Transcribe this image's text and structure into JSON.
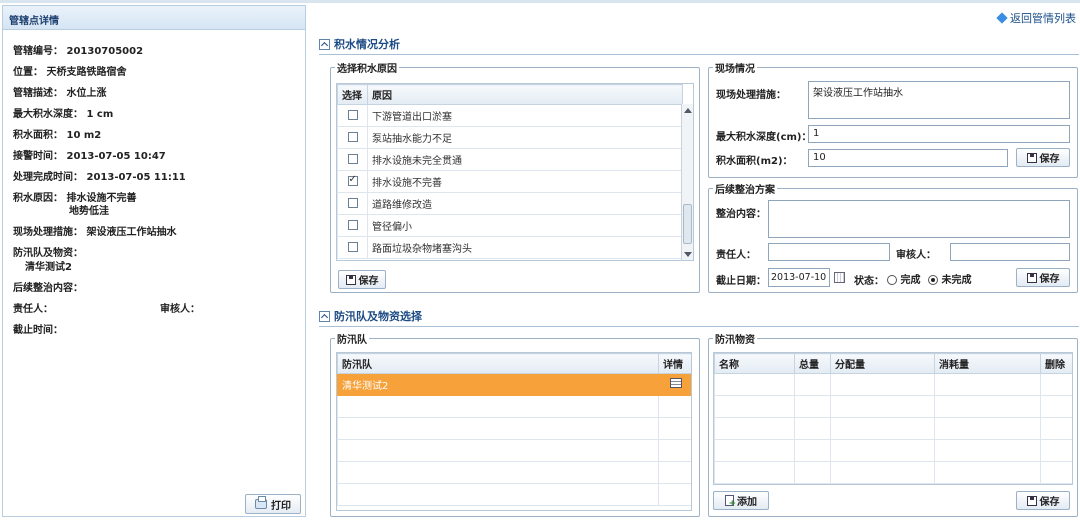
{
  "left": {
    "header": "管辖点详情",
    "fields": [
      {
        "label": "管辖编号：",
        "value": "20130705002"
      },
      {
        "label": "位置：",
        "value": "天桥支路铁路宿舍"
      },
      {
        "label": "管辖描述：",
        "value": "水位上涨"
      },
      {
        "label": "最大积水深度：",
        "value": "1 cm"
      },
      {
        "label": "积水面积：",
        "value": "10 m2"
      },
      {
        "label": "接警时间：",
        "value": "2013-07-05 10:47"
      },
      {
        "label": "处理完成时间：",
        "value": "2013-07-05 11:11"
      },
      {
        "label": "积水原因：",
        "value": "排水设施不完善"
      }
    ],
    "cause_second": "地势低洼",
    "onsite_label": "现场处理措施：",
    "onsite_value": "架设液压工作站抽水",
    "team_label": "防汛队及物资：",
    "team_value": "清华测试2",
    "plan_label": "后续整治内容：",
    "responsible_label": "责任人：",
    "reviewer_label": "审核人：",
    "deadline_label": "截止时间：",
    "print_label": "打印"
  },
  "return_link": "返回管情列表",
  "section1": {
    "title": "积水情况分析"
  },
  "cause_box": {
    "legend": "选择积水原因",
    "col_select": "选择",
    "col_reason": "原因",
    "rows": [
      {
        "reason": "下游管道出口淤塞",
        "checked": false
      },
      {
        "reason": "泵站抽水能力不足",
        "checked": false
      },
      {
        "reason": "排水设施未完全贯通",
        "checked": false
      },
      {
        "reason": "排水设施不完善",
        "checked": true
      },
      {
        "reason": "道路维修改造",
        "checked": false
      },
      {
        "reason": "管径偏小",
        "checked": false
      },
      {
        "reason": "路面垃圾杂物堵塞沟头",
        "checked": false
      }
    ],
    "save_label": "保存"
  },
  "site_box": {
    "legend": "现场情况",
    "measure_label": "现场处理措施：",
    "measure_value": "架设液压工作站抽水",
    "depth_label": "最大积水深度(cm)：",
    "depth_value": "1",
    "area_label": "积水面积(m2)：",
    "area_value": "10",
    "save_label": "保存"
  },
  "plan_box": {
    "legend": "后续整治方案",
    "content_label": "整治内容：",
    "responsible_label": "责任人：",
    "reviewer_label": "审核人：",
    "deadline_label": "截止日期：",
    "deadline_value": "2013-07-10",
    "status_label": "状态：",
    "status_done": "完成",
    "status_undone": "未完成",
    "save_label": "保存"
  },
  "section2": {
    "title": "防汛队及物资选择"
  },
  "team_box": {
    "legend": "防汛队",
    "col_team": "防汛队",
    "col_detail": "详情",
    "rows": [
      {
        "name": "清华测试2"
      }
    ]
  },
  "material_box": {
    "legend": "防汛物资",
    "cols": [
      "名称",
      "总量",
      "分配量",
      "消耗量",
      "删除"
    ],
    "add_label": "添加",
    "save_label": "保存"
  },
  "colors": {
    "selected_row": "#f6a13a",
    "title_blue": "#1d4b86"
  }
}
